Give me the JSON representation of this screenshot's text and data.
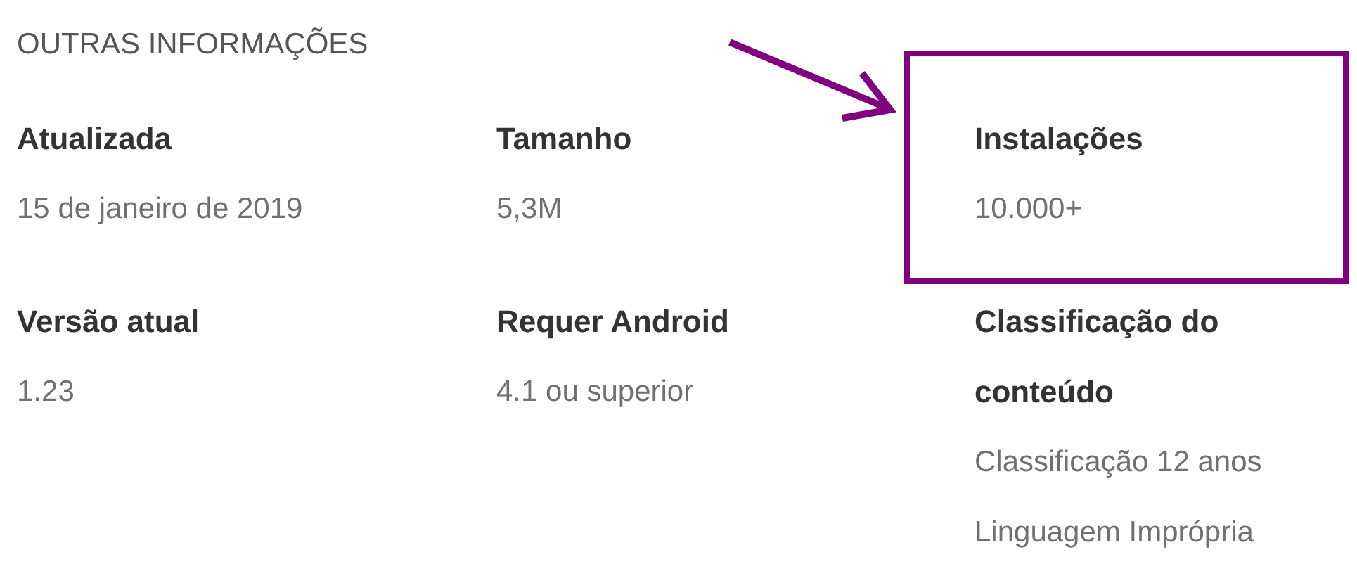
{
  "section_title": "OUTRAS INFORMAÇÕES",
  "items": [
    {
      "label": "Atualizada",
      "values": [
        "15 de janeiro de 2019"
      ],
      "highlighted": false
    },
    {
      "label": "Tamanho",
      "values": [
        "5,3M"
      ],
      "highlighted": false
    },
    {
      "label": "Instalações",
      "values": [
        "10.000+"
      ],
      "highlighted": true
    },
    {
      "label": "Versão atual",
      "values": [
        "1.23"
      ],
      "highlighted": false
    },
    {
      "label": "Requer Android",
      "values": [
        "4.1 ou superior"
      ],
      "highlighted": false
    },
    {
      "label": "Classificação do conteúdo",
      "values": [
        "Classificação 12 anos",
        "Linguagem Imprópria"
      ],
      "highlighted": false
    }
  ]
}
